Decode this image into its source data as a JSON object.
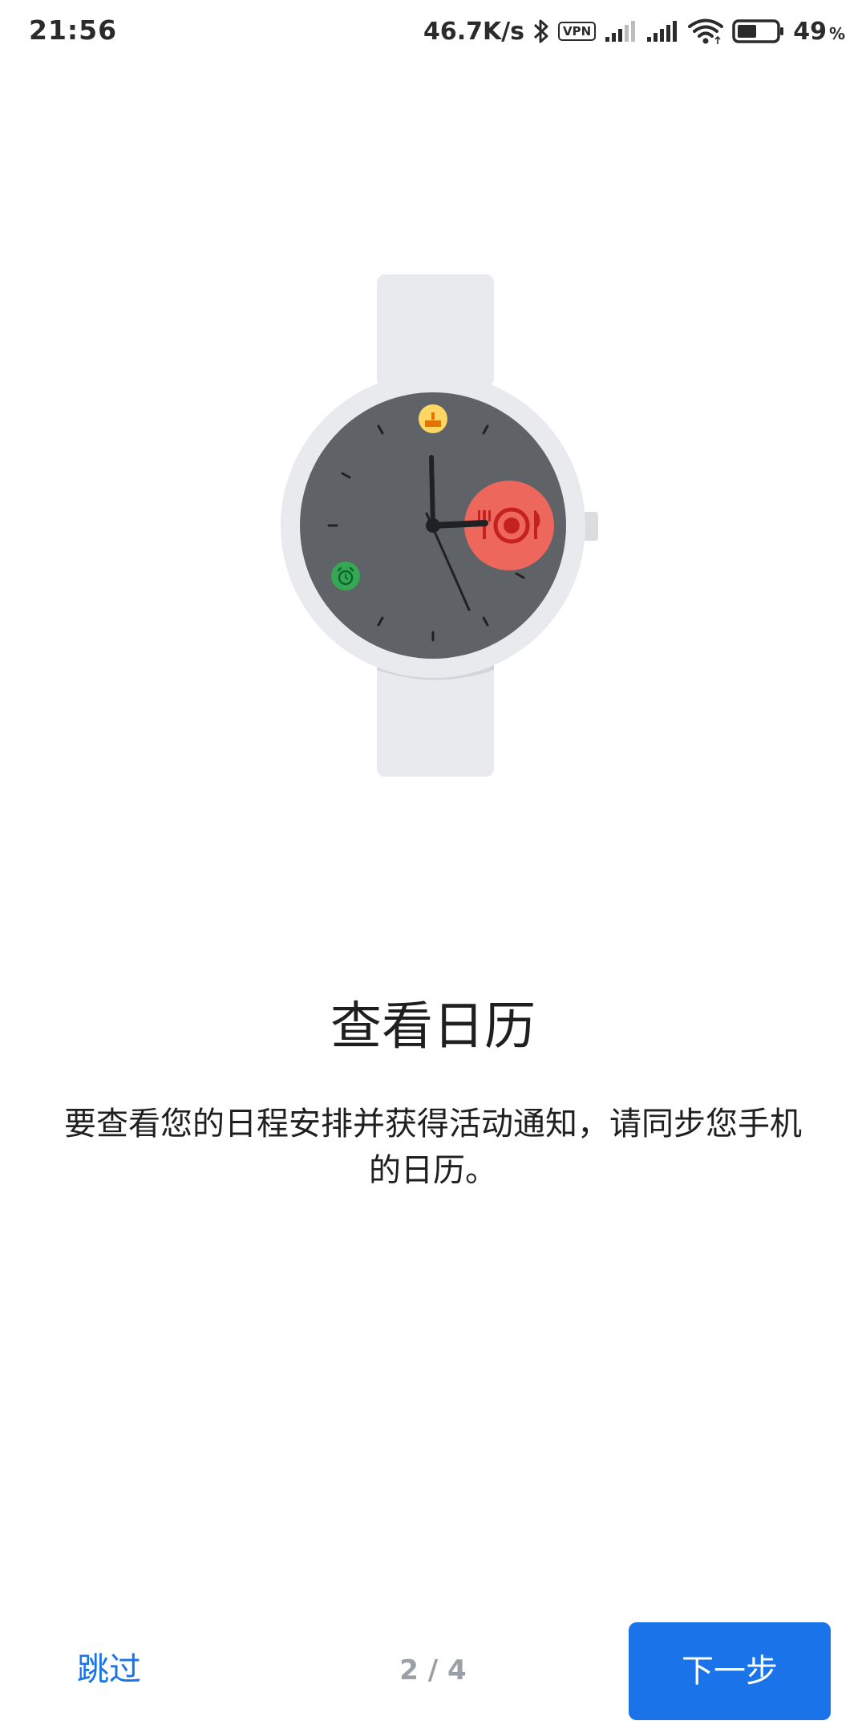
{
  "status_bar": {
    "time": "21:56",
    "net_speed": "46.7K/s",
    "vpn_label": "VPN",
    "battery_percent": "49",
    "battery_unit": "%",
    "battery_level": 0.49,
    "icons": [
      "bluetooth-icon",
      "vpn-icon",
      "signal-1-icon",
      "signal-2-icon",
      "wifi-icon",
      "battery-icon"
    ]
  },
  "illustration": {
    "type": "smartwatch",
    "colors": {
      "band": "#e8eaed",
      "bezel": "#e8eaed",
      "face": "#5f6368",
      "event_highlight": "#ee675c",
      "birthday_dot": "#fdd663",
      "alarm_dot": "#34a853"
    },
    "complications": [
      "cake-icon",
      "dining-icon",
      "alarm-icon"
    ]
  },
  "content": {
    "title": "查看日历",
    "description": "要查看您的日程安排并获得活动通知，请同步您手机的日历。"
  },
  "navigation": {
    "skip_label": "跳过",
    "page_indicator": "2 / 4",
    "next_label": "下一步",
    "accent_color": "#1a73e8"
  }
}
